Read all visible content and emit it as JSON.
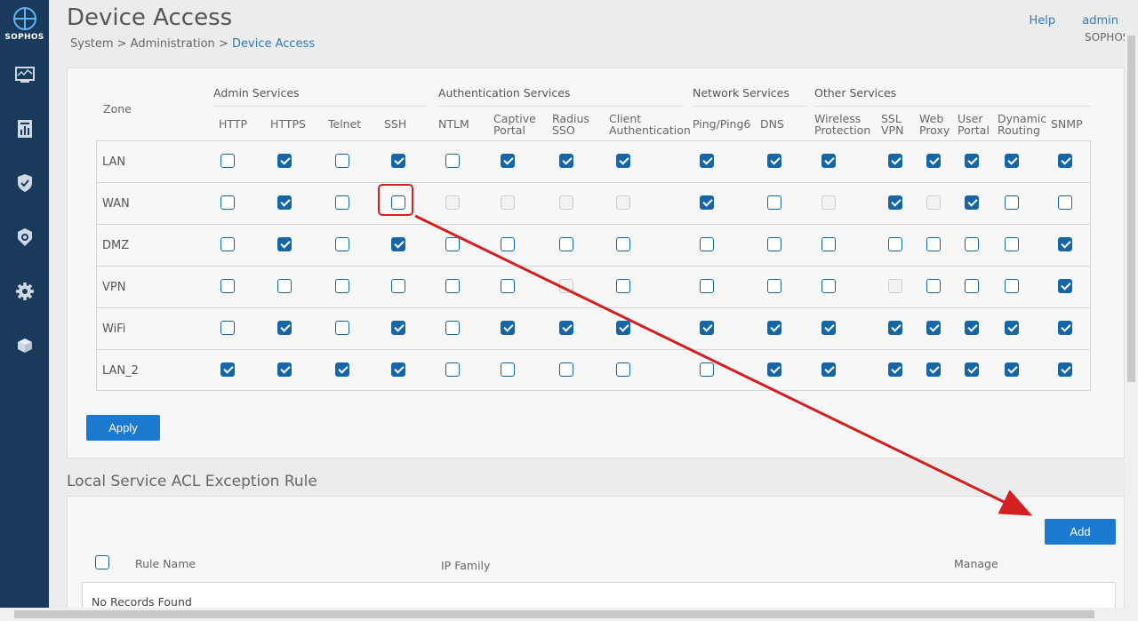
{
  "brand": {
    "logo_text": "SOPHOS"
  },
  "sidebar": {
    "icons": [
      "monitor-icon",
      "report-icon",
      "shield-icon",
      "protection-icon",
      "gear-icon",
      "box-icon"
    ]
  },
  "header": {
    "title": "Device Access",
    "breadcrumb": {
      "part1": "System",
      "sep": ">",
      "part2": "Administration",
      "current": "Device Access"
    },
    "help": "Help",
    "user": "admin",
    "org": "SOPHOS"
  },
  "services": {
    "zone_header": "Zone",
    "groups": [
      "Admin Services",
      "Authentication Services",
      "Network Services",
      "Other Services"
    ],
    "columns": [
      {
        "l1": "HTTP",
        "l2": ""
      },
      {
        "l1": "HTTPS",
        "l2": ""
      },
      {
        "l1": "Telnet",
        "l2": ""
      },
      {
        "l1": "SSH",
        "l2": ""
      },
      {
        "l1": "NTLM",
        "l2": ""
      },
      {
        "l1": "Captive",
        "l2": "Portal"
      },
      {
        "l1": "Radius",
        "l2": "SSO"
      },
      {
        "l1": "Client",
        "l2": "Authentication"
      },
      {
        "l1": "Ping/Ping6",
        "l2": ""
      },
      {
        "l1": "DNS",
        "l2": ""
      },
      {
        "l1": "Wireless",
        "l2": "Protection"
      },
      {
        "l1": "SSL",
        "l2": "VPN"
      },
      {
        "l1": "Web",
        "l2": "Proxy"
      },
      {
        "l1": "User",
        "l2": "Portal"
      },
      {
        "l1": "Dynamic",
        "l2": "Routing"
      },
      {
        "l1": "SNMP",
        "l2": ""
      }
    ],
    "rows": [
      {
        "zone": "LAN",
        "states": [
          "0",
          "1",
          "0",
          "1",
          "0",
          "1",
          "1",
          "1",
          "1",
          "1",
          "1",
          "1",
          "1",
          "1",
          "1",
          "1"
        ]
      },
      {
        "zone": "WAN",
        "states": [
          "0",
          "1",
          "0",
          "0",
          "d",
          "d",
          "d",
          "d",
          "1",
          "0",
          "d",
          "1",
          "d",
          "1",
          "0",
          "0"
        ]
      },
      {
        "zone": "DMZ",
        "states": [
          "0",
          "1",
          "0",
          "1",
          "0",
          "0",
          "0",
          "0",
          "0",
          "0",
          "0",
          "0",
          "0",
          "0",
          "0",
          "1"
        ]
      },
      {
        "zone": "VPN",
        "states": [
          "0",
          "0",
          "0",
          "0",
          "0",
          "0",
          "d",
          "0",
          "0",
          "0",
          "0",
          "d",
          "0",
          "0",
          "0",
          "1"
        ]
      },
      {
        "zone": "WiFi",
        "states": [
          "0",
          "1",
          "0",
          "1",
          "0",
          "1",
          "1",
          "1",
          "1",
          "1",
          "1",
          "1",
          "1",
          "1",
          "1",
          "1"
        ]
      },
      {
        "zone": "LAN_2",
        "states": [
          "1",
          "1",
          "1",
          "1",
          "0",
          "0",
          "0",
          "0",
          "0",
          "1",
          "1",
          "1",
          "1",
          "1",
          "1",
          "1"
        ]
      }
    ],
    "apply_label": "Apply"
  },
  "acl": {
    "title": "Local Service ACL Exception Rule",
    "add_label": "Add",
    "columns": [
      "Rule Name",
      "IP Family",
      "Manage"
    ],
    "empty_text": "No Records Found"
  },
  "colors": {
    "accent": "#1b7ad0",
    "sidebar": "#1a3a5c",
    "annotation": "#d42020"
  }
}
